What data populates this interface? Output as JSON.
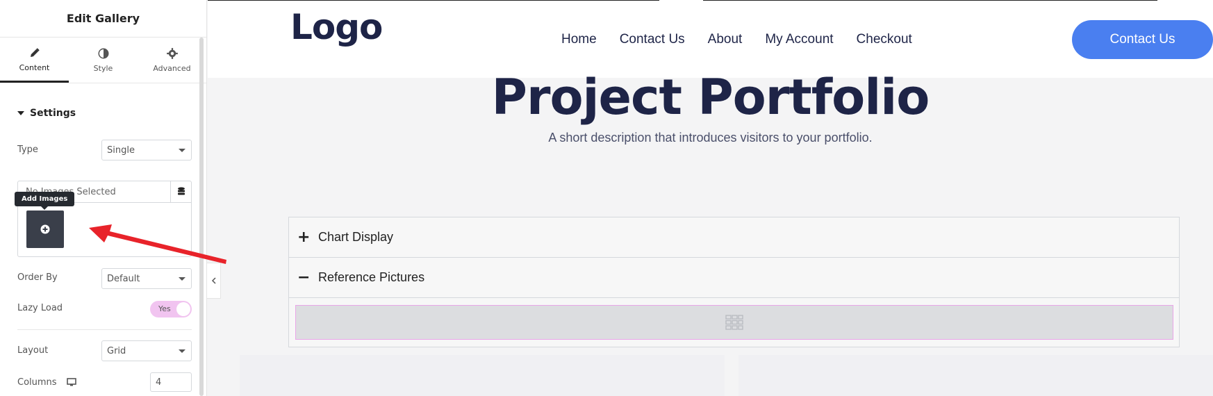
{
  "panel": {
    "title": "Edit Gallery",
    "tabs": [
      {
        "label": "Content",
        "icon": "pencil-icon",
        "active": true
      },
      {
        "label": "Style",
        "icon": "contrast-icon",
        "active": false
      },
      {
        "label": "Advanced",
        "icon": "gear-icon",
        "active": false
      }
    ],
    "section": "Settings",
    "type": {
      "label": "Type",
      "value": "Single"
    },
    "gallery": {
      "status": "No Images Selected",
      "tooltip": "Add Images"
    },
    "order_by": {
      "label": "Order By",
      "value": "Default"
    },
    "lazy_load": {
      "label": "Lazy Load",
      "value": "Yes"
    },
    "layout": {
      "label": "Layout",
      "value": "Grid"
    },
    "columns": {
      "label": "Columns",
      "value": "4"
    }
  },
  "site": {
    "logo": "Logo",
    "nav": [
      "Home",
      "Contact Us",
      "About",
      "My Account",
      "Checkout"
    ],
    "cta": "Contact Us",
    "hero_title": "Project Portfolio",
    "hero_subtitle": "A short description that introduces visitors to your portfolio.",
    "accordion": [
      {
        "title": "Chart Display",
        "icon": "plus-icon"
      },
      {
        "title": "Reference Pictures",
        "icon": "minus-icon"
      }
    ]
  },
  "colors": {
    "brand_navy": "#1e2447",
    "cta_blue": "#4a7ff0",
    "toggle_pink": "#f1c4f0",
    "arrow_red": "#e8232a"
  }
}
